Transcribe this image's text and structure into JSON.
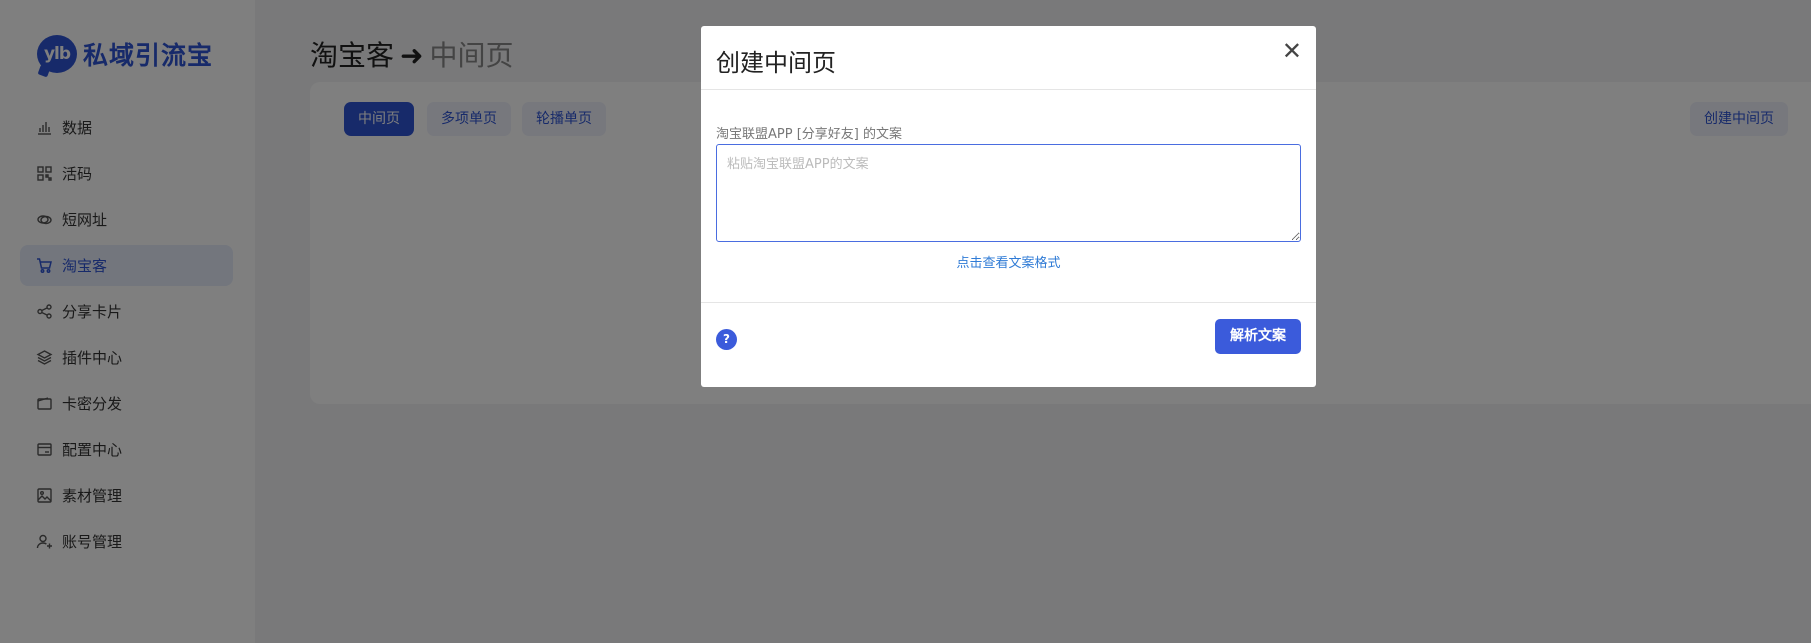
{
  "sidebar": {
    "logo_mark": "ylb",
    "logo_text": "私域引流宝",
    "items": [
      {
        "label": "数据",
        "icon": "bar-chart-icon"
      },
      {
        "label": "活码",
        "icon": "grid-icon"
      },
      {
        "label": "短网址",
        "icon": "link-icon"
      },
      {
        "label": "淘宝客",
        "icon": "cart-icon",
        "active": true
      },
      {
        "label": "分享卡片",
        "icon": "share-icon"
      },
      {
        "label": "插件中心",
        "icon": "layers-icon"
      },
      {
        "label": "卡密分发",
        "icon": "wallet-icon"
      },
      {
        "label": "配置中心",
        "icon": "config-icon"
      },
      {
        "label": "素材管理",
        "icon": "image-icon"
      },
      {
        "label": "账号管理",
        "icon": "user-icon"
      }
    ]
  },
  "header": {
    "title": "淘宝客",
    "arrow": "➜",
    "subtitle": "中间页"
  },
  "tabs": [
    {
      "label": "中间页",
      "active": true
    },
    {
      "label": "多项单页"
    },
    {
      "label": "轮播单页"
    }
  ],
  "create_button": "创建中间页",
  "modal": {
    "title": "创建中间页",
    "close": "✕",
    "field_label": "淘宝联盟APP [分享好友] 的文案",
    "placeholder": "粘贴淘宝联盟APP的文案",
    "format_link": "点击查看文案格式",
    "help": "?",
    "parse_button": "解析文案"
  },
  "colors": {
    "primary": "#2f55d4",
    "overlay": "rgba(0,0,0,0.5)"
  }
}
